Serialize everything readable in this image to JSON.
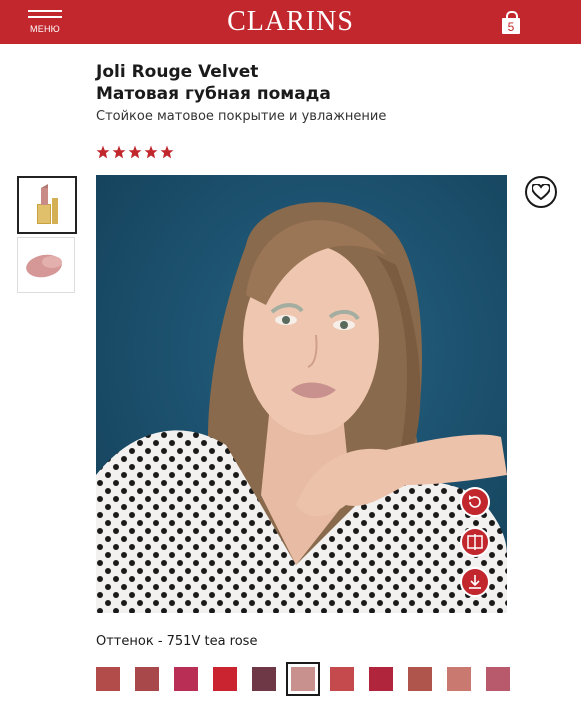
{
  "header": {
    "menu_label": "МЕНЮ",
    "brand": "CLARINS",
    "cart_count": "5",
    "background": "#c1272d"
  },
  "product": {
    "name": "Joli Rouge Velvet",
    "type": "Матовая губная помада",
    "description": "Стойкое матовое покрытие и увлажнение",
    "rating": 5
  },
  "gallery": {
    "thumbnails": [
      {
        "name": "lipstick-thumbnail",
        "active": true
      },
      {
        "name": "swatch-thumbnail",
        "active": false
      }
    ],
    "actions": [
      {
        "name": "reset-icon"
      },
      {
        "name": "compare-icon"
      },
      {
        "name": "download-icon"
      }
    ]
  },
  "shade": {
    "label": "Оттенок - 751V tea rose",
    "options": [
      {
        "color": "#b14c4b",
        "selected": false
      },
      {
        "color": "#a9484b",
        "selected": false
      },
      {
        "color": "#b82e55",
        "selected": false
      },
      {
        "color": "#c9242f",
        "selected": false
      },
      {
        "color": "#6e3846",
        "selected": false
      },
      {
        "color": "#c9918e",
        "selected": true
      },
      {
        "color": "#c44a4e",
        "selected": false
      },
      {
        "color": "#b0243c",
        "selected": false
      },
      {
        "color": "#b0554b",
        "selected": false
      },
      {
        "color": "#c9796f",
        "selected": false
      },
      {
        "color": "#b85a6b",
        "selected": false
      }
    ]
  }
}
